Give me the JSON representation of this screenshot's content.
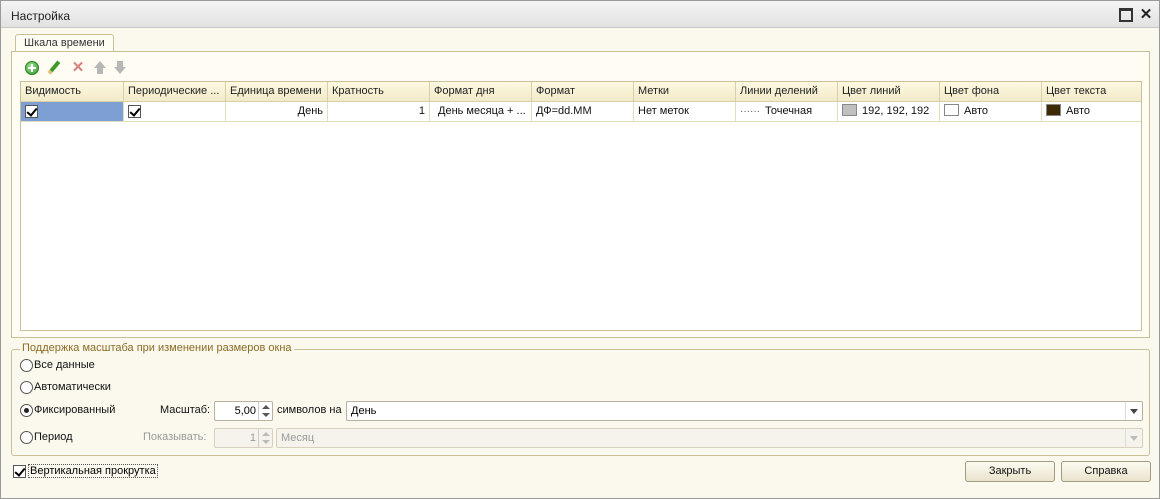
{
  "window": {
    "title": "Настройка"
  },
  "tab": {
    "label": "Шкала времени"
  },
  "toolbar": {
    "icons": [
      "add-icon",
      "edit-icon",
      "delete-icon",
      "move-up-icon",
      "move-down-icon"
    ]
  },
  "grid": {
    "columns": [
      "Видимость",
      "Периодические ...",
      "Единица времени",
      "Кратность",
      "Формат дня",
      "Формат",
      "Метки",
      "Линии делений",
      "Цвет линий",
      "Цвет фона",
      "Цвет текста"
    ],
    "rows": [
      {
        "visible": true,
        "periodic": true,
        "unit": "День",
        "multiplicity": "1",
        "day_format": "День месяца + ...",
        "format": "ДФ=dd.MM",
        "marks": "Нет меток",
        "division_lines": "Точечная",
        "line_color": "192, 192, 192",
        "line_color_hex": "#c0c0c0",
        "bg_color": "Авто",
        "bg_color_hex": "#ffffff",
        "text_color": "Авто",
        "text_color_hex": "#3d2a05"
      }
    ]
  },
  "scale_group": {
    "legend": "Поддержка масштаба при изменении размеров окна",
    "options": {
      "all_data": "Все данные",
      "auto": "Автоматически",
      "fixed": "Фиксированный",
      "period": "Период"
    },
    "selected": "fixed",
    "scale_label": "Масштаб:",
    "scale_value": "5,00",
    "symbols_label": "символов на",
    "unit_value": "День",
    "show_label": "Показывать:",
    "show_value": "1",
    "period_unit": "Месяц"
  },
  "footer": {
    "vertical_scroll_label": "Вертикальная прокрутка",
    "vertical_scroll_checked": true,
    "close_button": "Закрыть",
    "help_button": "Справка"
  }
}
